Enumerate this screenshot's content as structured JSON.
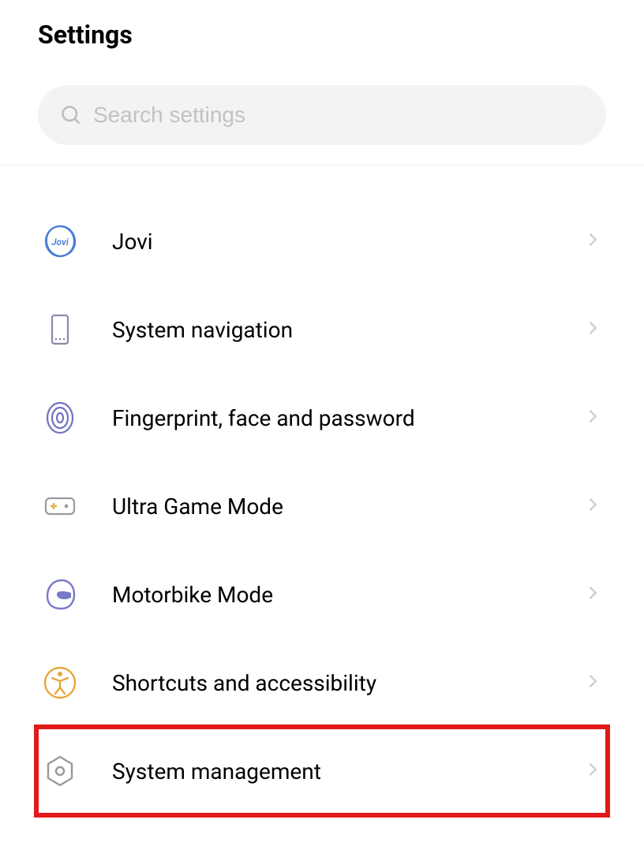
{
  "header": {
    "title": "Settings"
  },
  "search": {
    "placeholder": "Search settings"
  },
  "items": [
    {
      "id": "jovi",
      "label": "Jovi",
      "icon": "jovi",
      "highlighted": false
    },
    {
      "id": "system-navigation",
      "label": "System navigation",
      "icon": "phone-nav",
      "highlighted": false
    },
    {
      "id": "fingerprint-face-password",
      "label": "Fingerprint, face and password",
      "icon": "fingerprint",
      "highlighted": false
    },
    {
      "id": "ultra-game-mode",
      "label": "Ultra Game Mode",
      "icon": "gamepad",
      "highlighted": false
    },
    {
      "id": "motorbike-mode",
      "label": "Motorbike Mode",
      "icon": "helmet",
      "highlighted": false
    },
    {
      "id": "shortcuts-accessibility",
      "label": "Shortcuts and accessibility",
      "icon": "accessibility",
      "highlighted": false
    },
    {
      "id": "system-management",
      "label": "System management",
      "icon": "gear-hex",
      "highlighted": true
    }
  ]
}
